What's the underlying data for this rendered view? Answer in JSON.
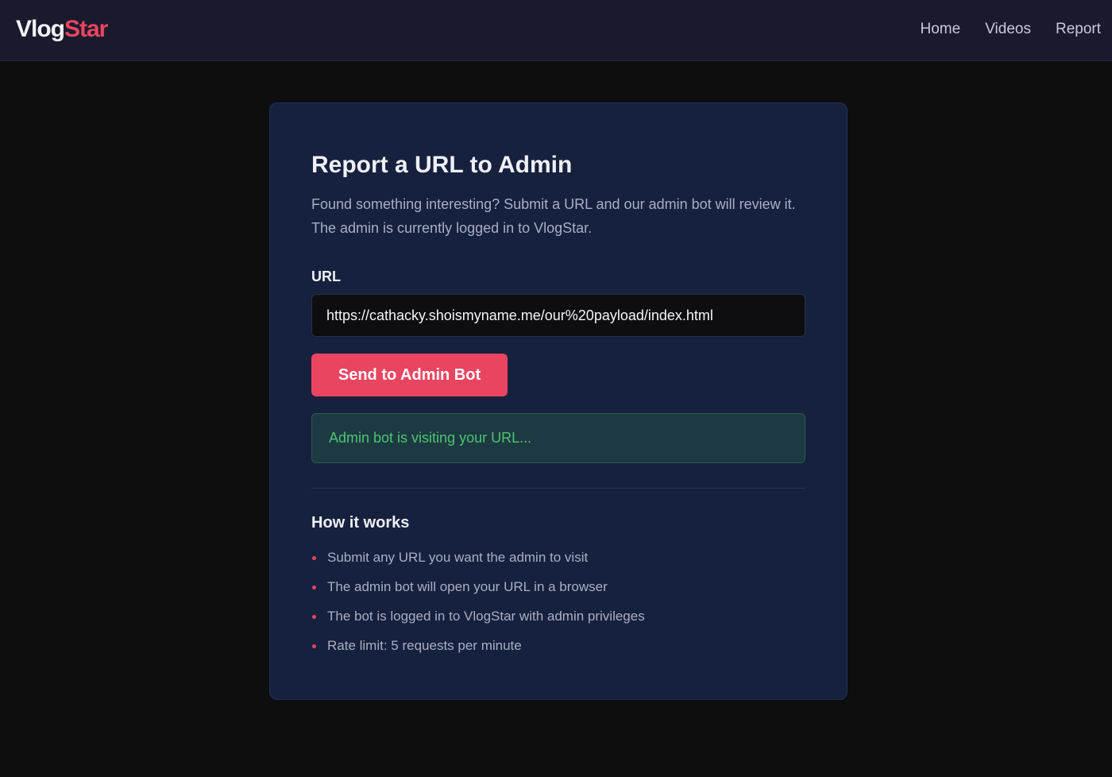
{
  "app": {
    "logo_part1": "Vlog",
    "logo_part2": "Star",
    "brand_color": "#e94560"
  },
  "nav": {
    "items": [
      {
        "label": "Home"
      },
      {
        "label": "Videos"
      },
      {
        "label": "Report"
      }
    ]
  },
  "report": {
    "title": "Report a URL to Admin",
    "description": "Found something interesting? Submit a URL and our admin bot will review it. The admin is currently logged in to VlogStar.",
    "url_label": "URL",
    "url_value": "https://cathacky.shoismyname.me/our%20payload/index.html",
    "submit_label": "Send to Admin Bot",
    "status_message": "Admin bot is visiting your URL..."
  },
  "how_it_works": {
    "title": "How it works",
    "items": [
      "Submit any URL you want the admin to visit",
      "The admin bot will open your URL in a browser",
      "The bot is logged in to VlogStar with admin privileges",
      "Rate limit: 5 requests per minute"
    ]
  }
}
